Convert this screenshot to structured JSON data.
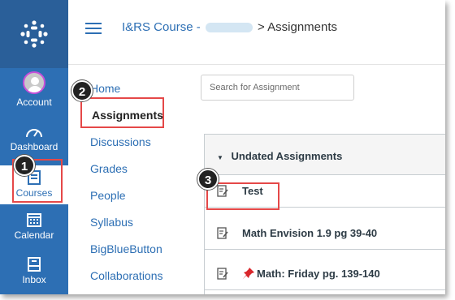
{
  "global_nav": {
    "account": "Account",
    "dashboard": "Dashboard",
    "courses": "Courses",
    "calendar": "Calendar",
    "inbox": "Inbox"
  },
  "header": {
    "course_name": "I&RS Course -",
    "separator": ">",
    "current_page": "Assignments"
  },
  "course_nav": {
    "items": [
      "Home",
      "Assignments",
      "Discussions",
      "Grades",
      "People",
      "Syllabus",
      "BigBlueButton",
      "Collaborations"
    ]
  },
  "search": {
    "placeholder": "Search for Assignment"
  },
  "assignments": {
    "group_title": "Undated Assignments",
    "items": [
      "Test",
      "Math Envision 1.9 pg 39-40",
      "Math: Friday pg. 139-140"
    ]
  },
  "steps": [
    "1",
    "2",
    "3"
  ],
  "colors": {
    "brand": "#2d6fb4",
    "highlight": "#e54848"
  }
}
